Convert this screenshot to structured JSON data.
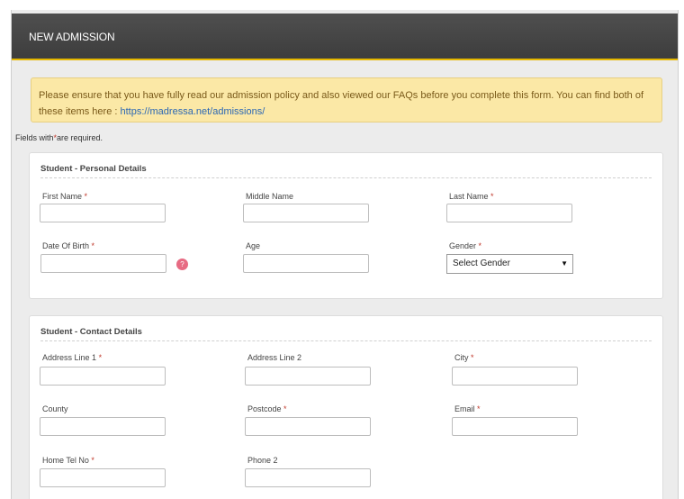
{
  "header": {
    "title": "NEW ADMISSION"
  },
  "notice": {
    "text": "Please ensure that you have fully read our admission policy and also viewed our FAQs before you complete this form. You can find both of these items here :",
    "link": "https://madressa.net/admissions/"
  },
  "fields_note": {
    "prefix": "Fields with",
    "star": "*",
    "suffix": "are required."
  },
  "personal": {
    "title": "Student - Personal Details",
    "first_name": "First Name",
    "middle_name": "Middle Name",
    "last_name": "Last Name",
    "dob": "Date Of Birth",
    "age": "Age",
    "gender": "Gender",
    "gender_select": "Select Gender",
    "help_icon": "?"
  },
  "contact": {
    "title": "Student - Contact Details",
    "address1": "Address Line 1",
    "address2": "Address Line 2",
    "city": "City",
    "county": "County",
    "postcode": "Postcode",
    "email": "Email",
    "home_tel": "Home Tel No",
    "phone2": "Phone 2"
  },
  "required_star": "*",
  "colors": {
    "accent": "#e5b700",
    "header_bg": "#444444",
    "required": "#c0392b",
    "notice_bg": "#fbe8a6"
  }
}
